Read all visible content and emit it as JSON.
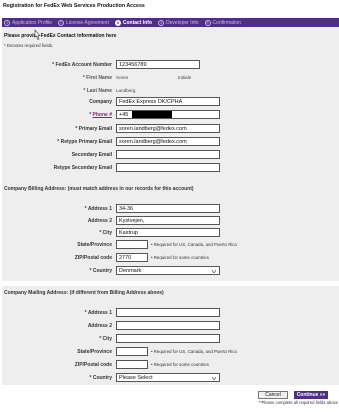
{
  "page": {
    "title": "Registration for FedEx Web Services Production Access"
  },
  "steps": [
    {
      "num": "1",
      "label": "Application Profile"
    },
    {
      "num": "2",
      "label": "License Agreement"
    },
    {
      "num": "3",
      "label": "Contact Info"
    },
    {
      "num": "4",
      "label": "Developer Info"
    },
    {
      "num": "5",
      "label": "Confirmation"
    }
  ],
  "active_step": 3,
  "intro": {
    "text": "Please provide FedEx Contact information here",
    "required_note": "* Denotes required fields."
  },
  "contact": {
    "account_number": {
      "label": "* FedEx Account Number",
      "value": "123456789"
    },
    "first_name": {
      "label": "* First Name",
      "value": "Soren"
    },
    "initials": {
      "label": "Initials"
    },
    "last_name": {
      "label": "* Last Name",
      "value": "Landberg"
    },
    "company": {
      "label": "Company",
      "value": "FedEx Express DK/CPHA"
    },
    "phone": {
      "label_star": "* ",
      "label_link": "Phone #",
      "value": "+45"
    },
    "primary_email": {
      "label": "* Primary Email",
      "value": "soren.landberg@fedex.com"
    },
    "retype_primary_email": {
      "label": "* Retype Primary Email",
      "value": "soren.landberg@fedex.com"
    },
    "secondary_email": {
      "label": "Secondary Email",
      "value": ""
    },
    "retype_secondary_email": {
      "label": "Retype Secondary Email",
      "value": ""
    }
  },
  "billing": {
    "title": "Company Billing Address: (must match address in our records for this account)",
    "address1": {
      "label": "* Address 1",
      "value": "34-36"
    },
    "address2": {
      "label": "Address 2",
      "value": "Kystvejen,"
    },
    "city": {
      "label": "* City",
      "value": "Kastrup"
    },
    "state": {
      "label": "State/Province",
      "value": "",
      "hint": "• Required for US, Canada, and Puerto Rico"
    },
    "zip": {
      "label": "ZIP/Postal code",
      "value": "2770",
      "hint": "• Required for some countries"
    },
    "country": {
      "label": "* Country",
      "value": "Denmark"
    }
  },
  "mailing": {
    "title": "Company Mailing Address: (if different from Billing Address above)",
    "address1": {
      "label": "* Address 1",
      "value": ""
    },
    "address2": {
      "label": "Address 2",
      "value": ""
    },
    "city": {
      "label": "* City",
      "value": ""
    },
    "state": {
      "label": "State/Province",
      "value": "",
      "hint": "• Required for US, Canada, and Puerto Rico"
    },
    "zip": {
      "label": "ZIP/Postal code",
      "value": "",
      "hint": "• Required for some countries"
    },
    "country": {
      "label": "* Country",
      "value": "Please Select"
    }
  },
  "actions": {
    "cancel": "Cancel",
    "continue": "Continue »»",
    "footer_note": "**Please complete all required fields above"
  },
  "colors": {
    "brand_purple": "#4e2f86",
    "link_purple": "#8b1f7d",
    "section_bg": "#eeeeee"
  }
}
